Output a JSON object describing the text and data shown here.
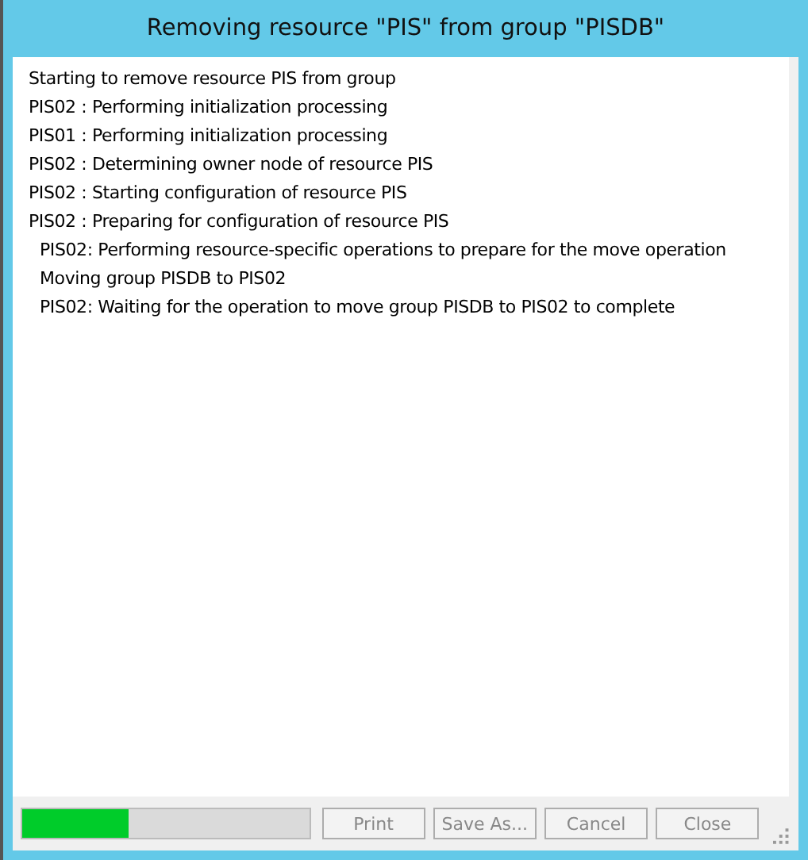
{
  "window": {
    "title": "Removing resource \"PIS\" from group \"PISDB\""
  },
  "log": [
    {
      "text": "Starting to remove resource PIS from group",
      "kind": "main"
    },
    {
      "text": "PIS02 : Performing initialization processing",
      "kind": "main"
    },
    {
      "text": "PIS01 : Performing initialization processing",
      "kind": "main"
    },
    {
      "text": "PIS02 : Determining owner node of resource PIS",
      "kind": "main"
    },
    {
      "text": "PIS02 : Starting configuration of resource PIS",
      "kind": "main"
    },
    {
      "text": "PIS02 : Preparing for configuration of resource PIS",
      "kind": "main"
    },
    {
      "text": "PIS02: Performing resource-specific operations to prepare for the move operation",
      "kind": "sub"
    },
    {
      "text": "Moving group PISDB to PIS02",
      "kind": "sub"
    },
    {
      "text": "PIS02: Waiting for the operation to move group PISDB to PIS02 to complete",
      "kind": "sub"
    }
  ],
  "progress": {
    "level": 0.37
  },
  "buttons": [
    {
      "label": "Print",
      "disabled": true
    },
    {
      "label": "Save As...",
      "disabled": true
    },
    {
      "label": "Cancel",
      "disabled": true
    },
    {
      "label": "Close",
      "disabled": true
    }
  ]
}
